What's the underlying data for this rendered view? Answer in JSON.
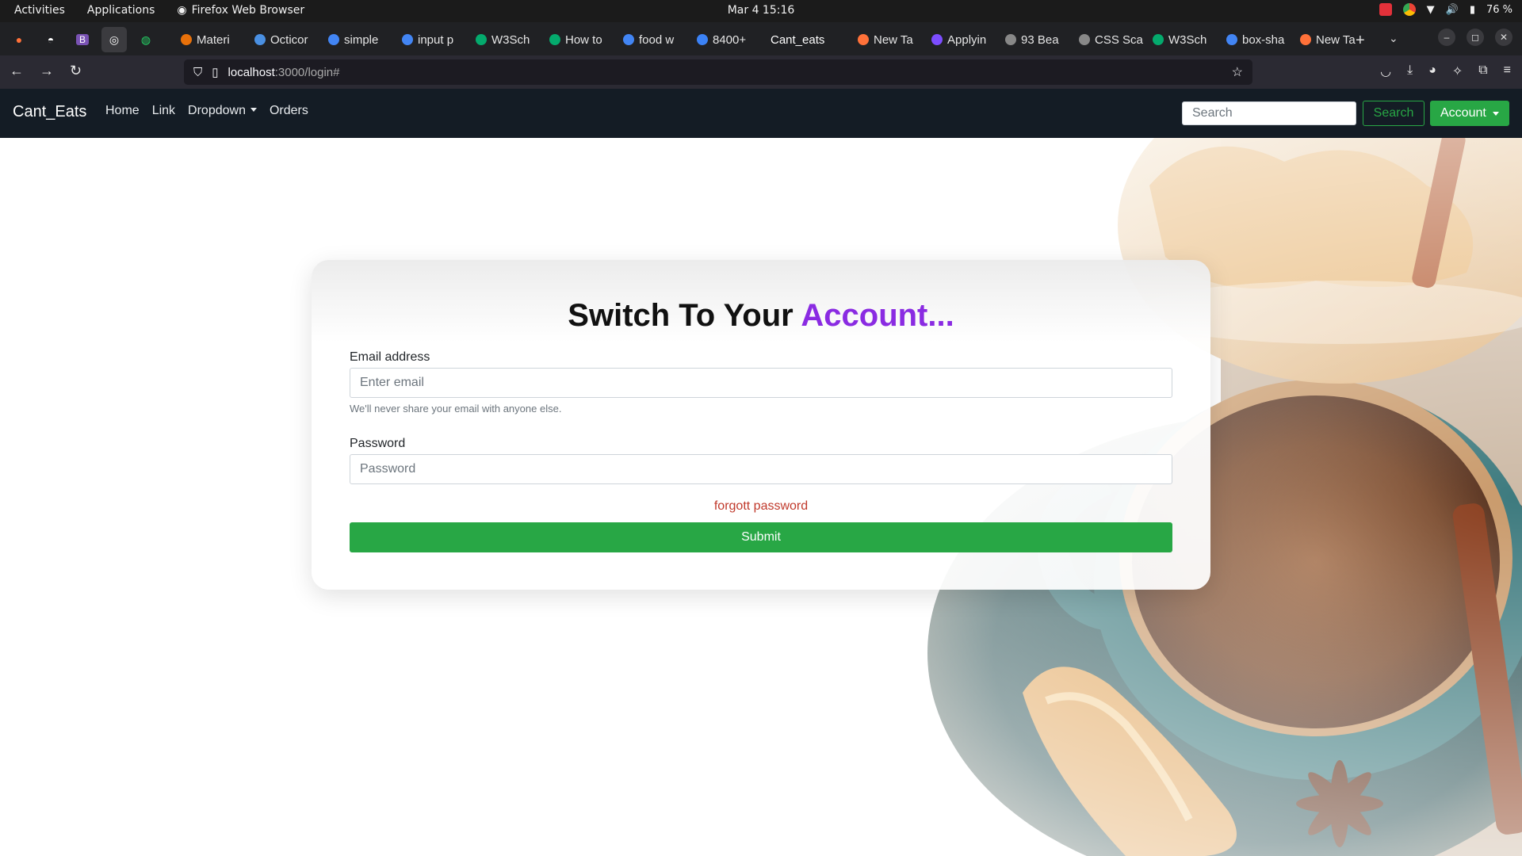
{
  "os": {
    "activities": "Activities",
    "applications": "Applications",
    "app_name": "Firefox Web Browser",
    "clock": "Mar 4  15:16",
    "battery": "76 %"
  },
  "browser": {
    "tabs": [
      {
        "label": "Materi",
        "color": "#e8710a"
      },
      {
        "label": "Octicor",
        "color": "#4a90e2"
      },
      {
        "label": "simple",
        "color": "#4285f4"
      },
      {
        "label": "input p",
        "color": "#4285f4"
      },
      {
        "label": "W3Sch",
        "color": "#04aa6d"
      },
      {
        "label": "How to",
        "color": "#04aa6d"
      },
      {
        "label": "food w",
        "color": "#4285f4"
      },
      {
        "label": "8400+",
        "color": "#3b82f6"
      },
      {
        "label": "Cant_eats",
        "color": "#202124"
      },
      {
        "label": "New Ta",
        "color": "#ff7139"
      },
      {
        "label": "Applyin",
        "color": "#7c4dff"
      },
      {
        "label": "93 Bea",
        "color": "#888888"
      },
      {
        "label": "CSS Sca",
        "color": "#888888"
      },
      {
        "label": "W3Sch",
        "color": "#04aa6d"
      },
      {
        "label": "box-sha",
        "color": "#4285f4"
      },
      {
        "label": "New Ta",
        "color": "#ff7139"
      }
    ],
    "url_host": "localhost",
    "url_path": ":3000/login#"
  },
  "site": {
    "brand": "Cant_Eats",
    "menu": {
      "home": "Home",
      "link": "Link",
      "dropdown": "Dropdown",
      "orders": "Orders"
    },
    "search_placeholder": "Search",
    "search_button": "Search",
    "account_button": "Account"
  },
  "login": {
    "title_main": "Switch To Your ",
    "title_accent": "Account...",
    "email_label": "Email address",
    "email_placeholder": "Enter email",
    "email_help": "We'll never share your email with anyone else.",
    "password_label": "Password",
    "password_placeholder": "Password",
    "forgot": "forgott password",
    "submit": "Submit"
  },
  "colors": {
    "accent_purple": "#8a2be2",
    "success_green": "#28a745",
    "nav_dark": "#141c25"
  }
}
